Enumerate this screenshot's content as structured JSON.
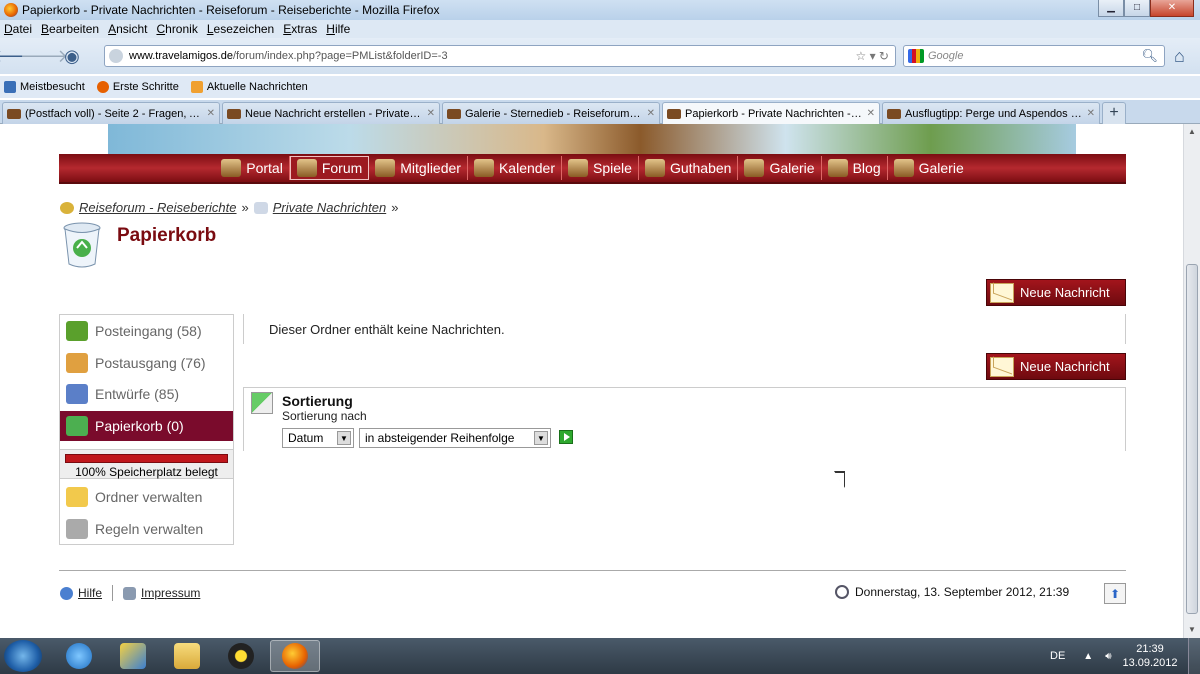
{
  "window": {
    "title": "Papierkorb - Private Nachrichten - Reiseforum - Reiseberichte - Mozilla Firefox"
  },
  "menu": [
    "Datei",
    "Bearbeiten",
    "Ansicht",
    "Chronik",
    "Lesezeichen",
    "Extras",
    "Hilfe"
  ],
  "address": {
    "host": "www.travelamigos.de",
    "path": "/forum/index.php?page=PMList&folderID=-3"
  },
  "search": {
    "placeholder": "Google"
  },
  "bookmarks": [
    "Meistbesucht",
    "Erste Schritte",
    "Aktuelle Nachrichten"
  ],
  "tabs": [
    {
      "label": "(Postfach voll) - Seite 2 - Fragen, Anr...",
      "active": false
    },
    {
      "label": "Neue Nachricht erstellen - Private Na...",
      "active": false
    },
    {
      "label": "Galerie - Sternedieb - Reiseforum - Re...",
      "active": false
    },
    {
      "label": "Papierkorb - Private Nachrichten - Re...",
      "active": true
    },
    {
      "label": "Ausflugtipp: Perge und Aspendos ab ...",
      "active": false
    }
  ],
  "mainnav": [
    {
      "label": "Portal",
      "active": false
    },
    {
      "label": "Forum",
      "active": true
    },
    {
      "label": "Mitglieder",
      "active": false
    },
    {
      "label": "Kalender",
      "active": false
    },
    {
      "label": "Spiele",
      "active": false
    },
    {
      "label": "Guthaben",
      "active": false
    },
    {
      "label": "Galerie",
      "active": false
    },
    {
      "label": "Blog",
      "active": false
    },
    {
      "label": "Galerie",
      "active": false
    }
  ],
  "breadcrumb": [
    "Reiseforum - Reiseberichte",
    "Private Nachrichten"
  ],
  "breadcrumb_sep": "»",
  "page": {
    "title": "Papierkorb"
  },
  "actions": {
    "new_message": "Neue Nachricht"
  },
  "sidebar": {
    "items": [
      {
        "label": "Posteingang (58)",
        "color": "#5aa02c"
      },
      {
        "label": "Postausgang (76)",
        "color": "#e0a040"
      },
      {
        "label": "Entwürfe (85)",
        "color": "#5b7fc8"
      },
      {
        "label": "Papierkorb (0)",
        "color": "#4caf50",
        "active": true
      }
    ],
    "storage": {
      "percent": 100,
      "label": "100% Speicherplatz belegt"
    },
    "tools": [
      {
        "label": "Ordner verwalten",
        "color": "#f2c94c"
      },
      {
        "label": "Regeln verwalten",
        "color": "#aaaaaa"
      }
    ]
  },
  "content": {
    "empty_message": "Dieser Ordner enthält keine Nachrichten.",
    "sort": {
      "heading": "Sortierung",
      "subheading": "Sortierung nach",
      "field_value": "Datum",
      "order_value": "in absteigender Reihenfolge"
    }
  },
  "footer": {
    "help": "Hilfe",
    "imprint": "Impressum",
    "datetime": "Donnerstag, 13. September 2012, 21:39"
  },
  "taskbar": {
    "lang": "DE",
    "time": "21:39",
    "date": "13.09.2012"
  }
}
